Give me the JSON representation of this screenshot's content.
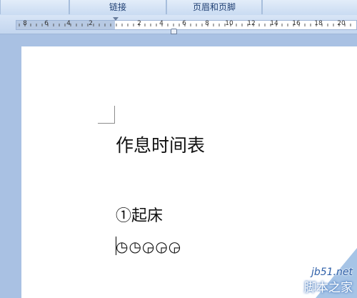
{
  "ribbon": {
    "groups": [
      {
        "label": ""
      },
      {
        "label": "链接"
      },
      {
        "label": "页眉和页脚"
      },
      {
        "label": ""
      }
    ]
  },
  "ruler": {
    "labels": [
      "8",
      "6",
      "4",
      "2",
      "2",
      "4",
      "6",
      "8",
      "10",
      "12",
      "14",
      "16",
      "18",
      "20"
    ]
  },
  "document": {
    "title": "作息时间表",
    "item_1": "①起床",
    "clock_symbols": "◷◷◶◶◶"
  },
  "watermark": {
    "site": "jb51.net",
    "brand": "脚本之家"
  },
  "colors": {
    "workspace": "#a9c1e3",
    "ribbon": "#dbe6f6",
    "page": "#ffffff"
  }
}
